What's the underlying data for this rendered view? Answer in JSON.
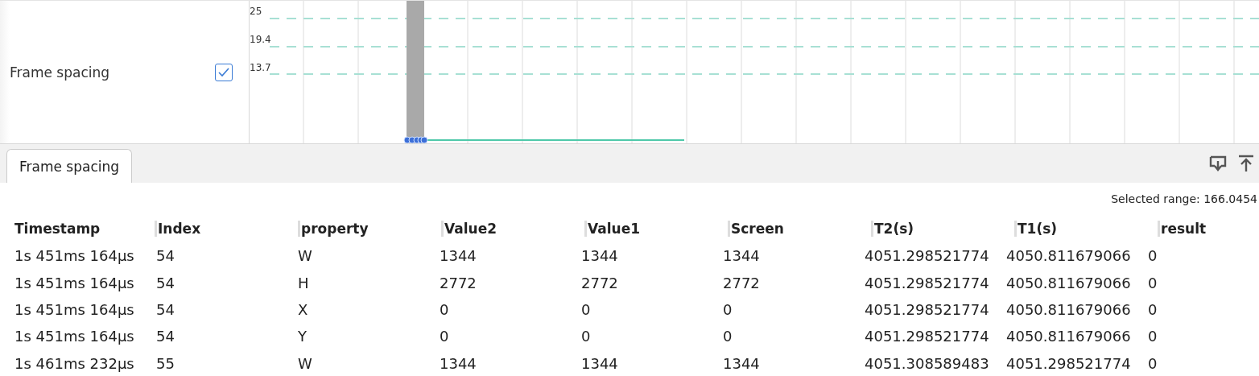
{
  "track": {
    "label": "Frame spacing",
    "checked": true,
    "y_ticks": [
      "25",
      "19.4",
      "13.7"
    ]
  },
  "tabs": [
    {
      "label": "Frame spacing",
      "selected": true
    }
  ],
  "selected_range": "Selected range: 166.0454",
  "table": {
    "columns": [
      "Timestamp",
      "Index",
      "property",
      "Value2",
      "Value1",
      "Screen",
      "T2(s)",
      "T1(s)",
      "result"
    ],
    "rows": [
      [
        "1s 451ms 164μs",
        "54",
        "W",
        "1344",
        "1344",
        "1344",
        "4051.298521774",
        "4050.811679066",
        "0"
      ],
      [
        "1s 451ms 164μs",
        "54",
        "H",
        "2772",
        "2772",
        "2772",
        "4051.298521774",
        "4050.811679066",
        "0"
      ],
      [
        "1s 451ms 164μs",
        "54",
        "X",
        "0",
        "0",
        "0",
        "4051.298521774",
        "4050.811679066",
        "0"
      ],
      [
        "1s 451ms 164μs",
        "54",
        "Y",
        "0",
        "0",
        "0",
        "4051.298521774",
        "4050.811679066",
        "0"
      ],
      [
        "1s 461ms 232μs",
        "55",
        "W",
        "1344",
        "1344",
        "1344",
        "4051.308589483",
        "4051.298521774",
        "0"
      ]
    ]
  }
}
